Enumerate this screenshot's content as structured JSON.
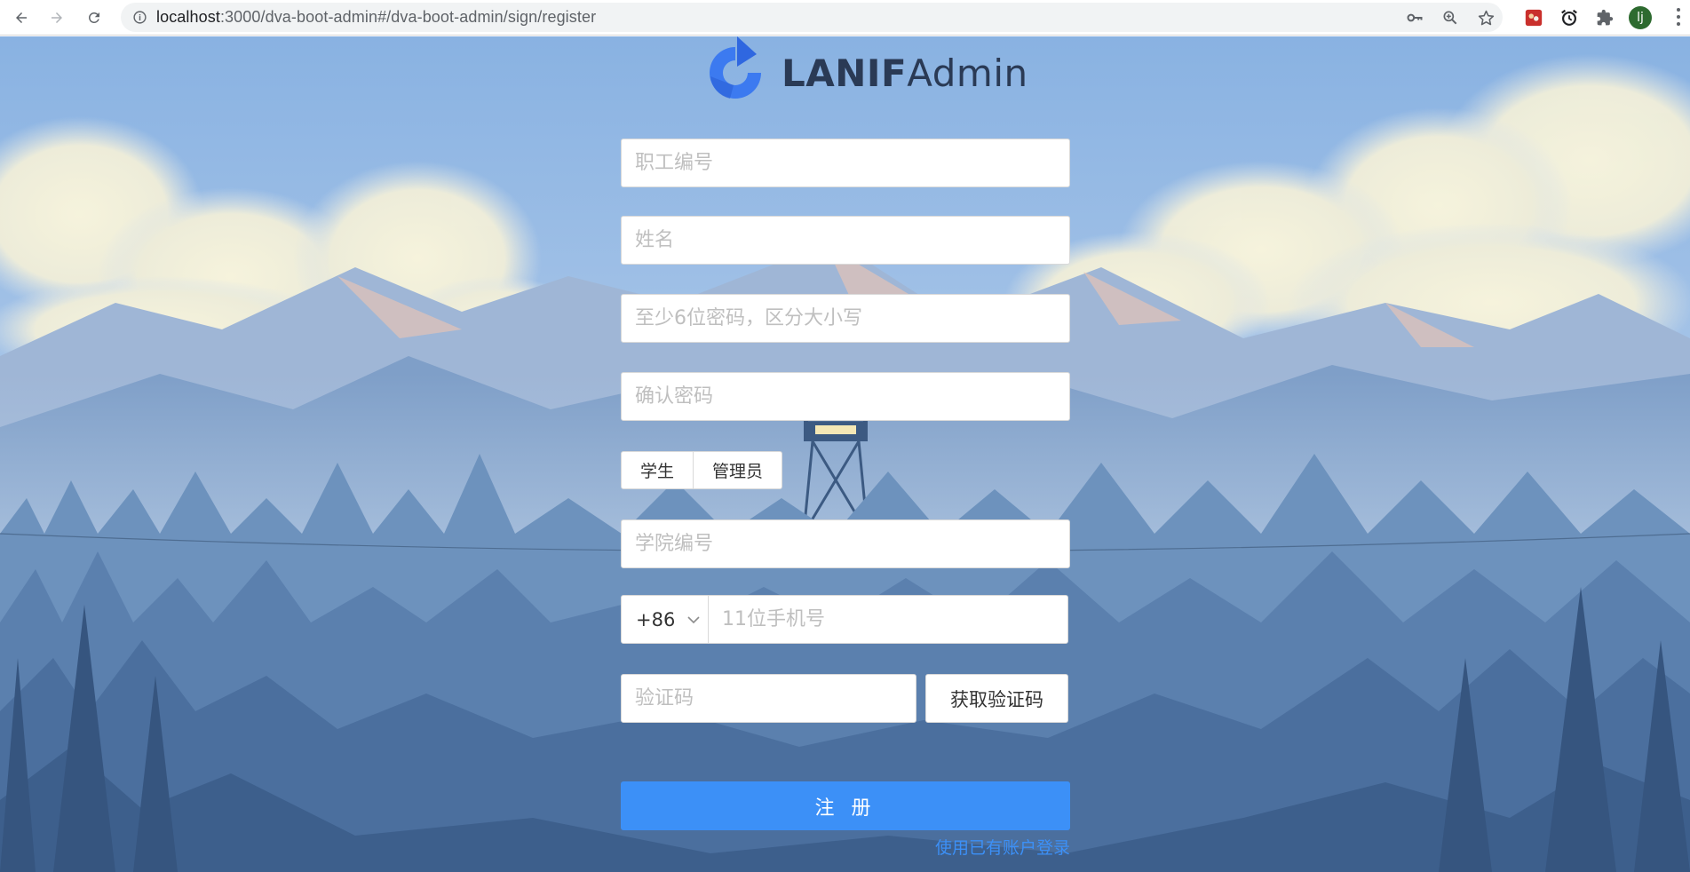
{
  "browser": {
    "url_host": "localhost",
    "url_rest": ":3000/dva-boot-admin#/dva-boot-admin/sign/register",
    "profile_initial": "lj",
    "icons": [
      "back-icon",
      "forward-icon",
      "reload-icon",
      "info-icon",
      "key-icon",
      "zoom-icon",
      "star-icon",
      "extension-red-icon",
      "alarm-icon",
      "puzzle-icon",
      "menu-icon"
    ]
  },
  "logo": {
    "bold": "LANIF",
    "regular": "Admin",
    "color": "#3c7af0"
  },
  "form": {
    "employee_id_placeholder": "职工编号",
    "name_placeholder": "姓名",
    "password_placeholder": "至少6位密码，区分大小写",
    "confirm_password_placeholder": "确认密码",
    "roles": [
      "学生",
      "管理员"
    ],
    "college_id_placeholder": "学院编号",
    "phone_prefix": "+86",
    "phone_placeholder": "11位手机号",
    "code_placeholder": "验证码",
    "get_code_label": "获取验证码",
    "submit_label": "注 册",
    "login_link": "使用已有账户登录"
  },
  "colors": {
    "primary": "#3c90f7",
    "sky": "#9fc1e8",
    "forest": "#3e6f9c"
  }
}
